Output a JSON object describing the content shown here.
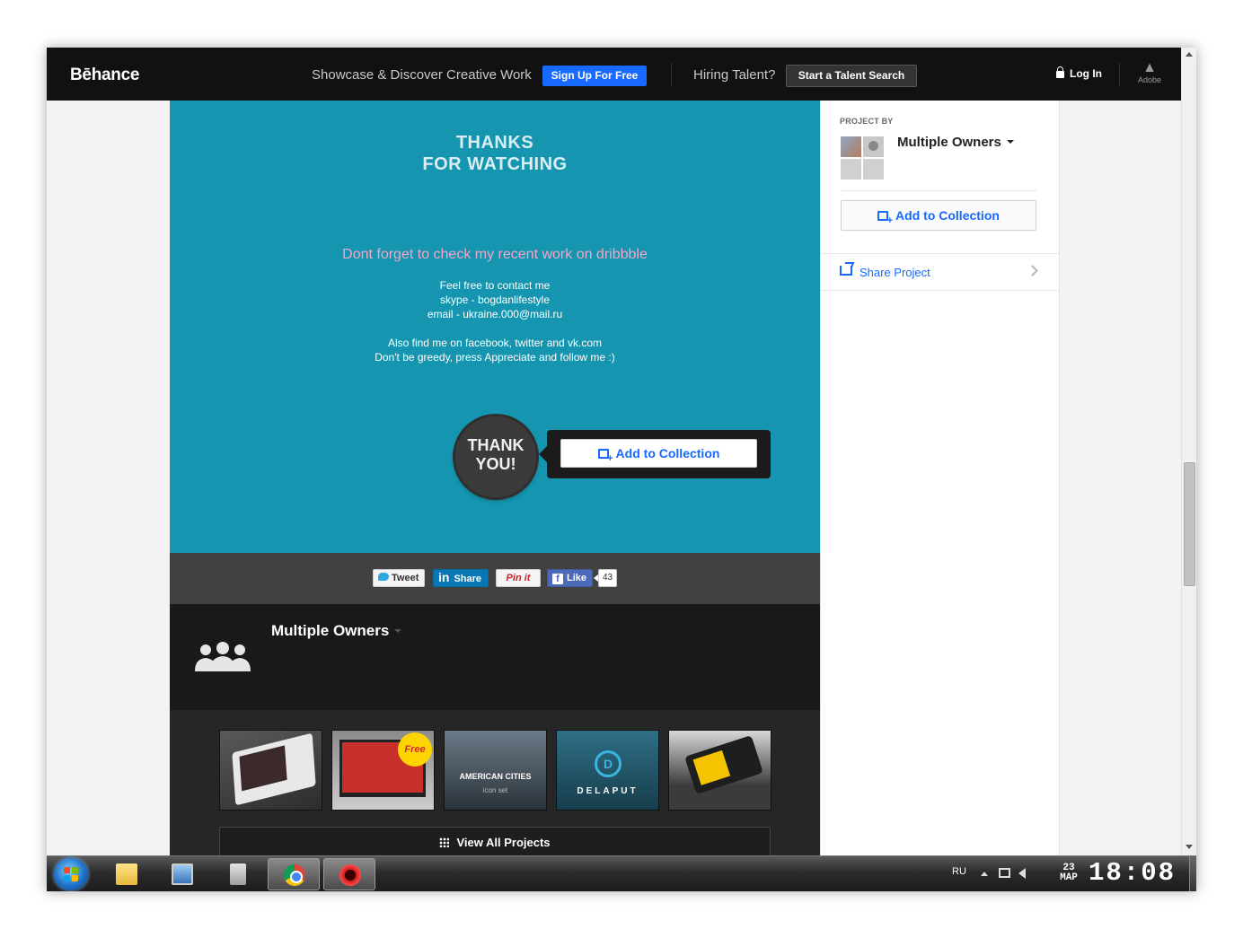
{
  "header": {
    "logo": "Bēhance",
    "tagline": "Showcase & Discover Creative Work",
    "signup_label": "Sign Up For Free",
    "hiring_label": "Hiring Talent?",
    "talent_search_label": "Start a Talent Search",
    "login_label": "Log In",
    "adobe_label": "Adobe"
  },
  "project": {
    "thanks_title_line1": "THANKS",
    "thanks_title_line2": "FOR WATCHING",
    "dribbble_text": "Dont forget to check my recent work on dribbble",
    "contact_line1": "Feel free to contact me",
    "contact_line2": "skype - bogdanlifestyle",
    "contact_line3": "email - ukraine.000@mail.ru",
    "social_line1": "Also find me on facebook, twitter and vk.com",
    "social_line2": "Don't be greedy, press Appreciate and follow me :)",
    "badge_line1": "THANK",
    "badge_line2": "YOU!",
    "add_to_collection_label": "Add to Collection"
  },
  "share_bar": {
    "tweet_label": "Tweet",
    "linkedin_logo": "in",
    "linkedin_label": "Share",
    "pinit_label": "Pin it",
    "facebook_label": "Like",
    "facebook_count": "43"
  },
  "owner": {
    "name": "Multiple Owners"
  },
  "more_projects": {
    "thumbnails": [
      {
        "label": ""
      },
      {
        "label": "Free"
      },
      {
        "label": "AMERICAN CITIES",
        "sub": "icon set"
      },
      {
        "label": "DELAPUT",
        "logo": "D"
      },
      {
        "label": ""
      }
    ],
    "view_all_label": "View All Projects"
  },
  "sidebar": {
    "project_by_label": "PROJECT BY",
    "owner_name": "Multiple Owners",
    "add_to_collection_label": "Add to Collection",
    "share_project_label": "Share Project"
  },
  "taskbar": {
    "language": "RU",
    "date_day": "23",
    "date_month": "МАР",
    "time": "18:08"
  },
  "colors": {
    "behance_blue": "#1769ff",
    "teal_background": "#1595af",
    "header_black": "#111111",
    "dribbble_pink": "#f0a7c8"
  }
}
